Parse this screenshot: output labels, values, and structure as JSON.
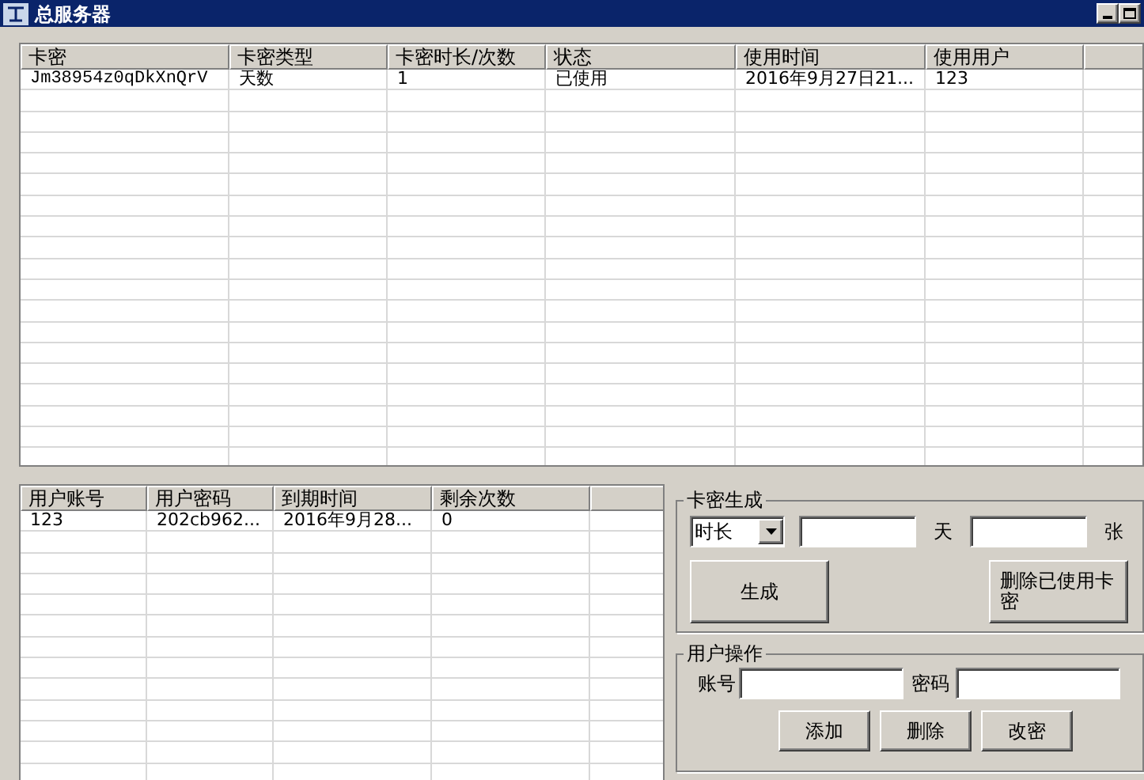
{
  "window": {
    "title": "总服务器"
  },
  "card_table": {
    "columns": [
      "卡密",
      "卡密类型",
      "卡密时长/次数",
      "状态",
      "使用时间",
      "使用用户"
    ],
    "rows": [
      [
        "Jm38954z0qDkXnQrV",
        "天数",
        "1",
        "已使用",
        "2016年9月27日21...",
        "123"
      ]
    ]
  },
  "user_table": {
    "columns": [
      "用户账号",
      "用户密码",
      "到期时间",
      "剩余次数"
    ],
    "rows": [
      [
        "123",
        "202cb962...",
        "2016年9月28...",
        "0"
      ]
    ]
  },
  "card_gen": {
    "title": "卡密生成",
    "type_select": "时长",
    "unit_days": "天",
    "unit_count": "张",
    "buttons": [
      "生成",
      "删除已使用卡密"
    ]
  },
  "user_ops": {
    "title": "用户操作",
    "account_label": "账号",
    "password_label": "密码",
    "buttons": [
      "添加",
      "删除",
      "改密"
    ]
  }
}
